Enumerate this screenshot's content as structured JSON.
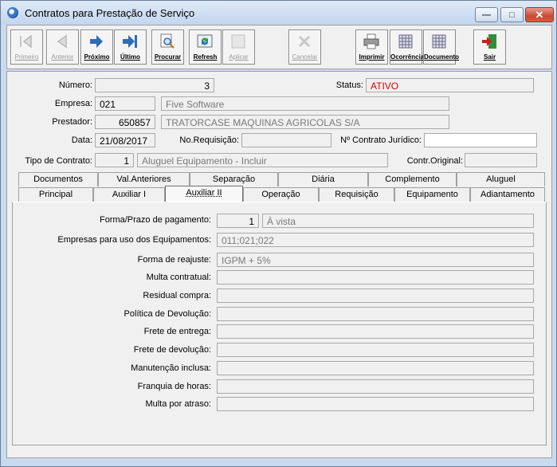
{
  "window": {
    "title": "Contratos para Prestação de Serviço",
    "minimize_icon": "minimize-icon",
    "maximize_icon": "maximize-icon",
    "close_icon": "close-icon"
  },
  "toolbar": {
    "primeiro": "Primeiro",
    "anterior": "Anterior",
    "proximo": "Próximo",
    "ultimo": "Último",
    "procurar": "Procurar",
    "refresh": "Refresh",
    "aplicar": "Aplicar",
    "cancelar": "Cancelar",
    "imprimir": "Imprimir",
    "ocorrencia": "Ocorrência",
    "documento": "Documento",
    "sair": "Sair"
  },
  "header": {
    "numero_label": "Número:",
    "numero": "3",
    "status_label": "Status:",
    "status": "ATIVO",
    "empresa_label": "Empresa:",
    "empresa_codigo": "021",
    "empresa_nome": "Five Software",
    "prestador_label": "Prestador:",
    "prestador_codigo": "650857",
    "prestador_nome": "TRATORCASE MAQUINAS AGRICOLAS S/A",
    "data_label": "Data:",
    "data": "21/08/2017",
    "requisicao_label": "No.Requisição:",
    "requisicao": "",
    "juridico_label": "Nº Contrato Jurídico:",
    "juridico": "",
    "tipo_label": "Tipo de Contrato:",
    "tipo_codigo": "1",
    "tipo_nome": "Aluguel Equipamento - Incluir",
    "original_label": "Contr.Original:",
    "original": ""
  },
  "tabs": {
    "row1": [
      "Documentos",
      "Val.Anteriores",
      "Separação",
      "Diária",
      "Complemento",
      "Aluguel"
    ],
    "row2": [
      "Principal",
      "Auxiliar I",
      "Auxiliar II",
      "Operação",
      "Requisição",
      "Equipamento",
      "Adiantamento"
    ],
    "active": "Auxiliar II"
  },
  "form": {
    "prazo_label": "Forma/Prazo de pagamento:",
    "prazo_codigo": "1",
    "prazo_desc": "À vista",
    "empresas_label": "Empresas para uso dos Equipamentos:",
    "empresas": "011;021;022",
    "reajuste_label": "Forma de reajuste:",
    "reajuste": "IGPM + 5%",
    "multa_contratual_label": "Multa contratual:",
    "multa_contratual": "",
    "residual_label": "Residual compra:",
    "residual": "",
    "devolucao_label": "Política de Devolução:",
    "devolucao": "",
    "frete_entrega_label": "Frete de entrega:",
    "frete_entrega": "",
    "frete_devolucao_label": "Frete de devolução:",
    "frete_devolucao": "",
    "manutencao_label": "Manutenção inclusa:",
    "manutencao": "",
    "franquia_label": "Franquia de horas:",
    "franquia": "",
    "multa_atraso_label": "Multa por atraso:",
    "multa_atraso": ""
  },
  "colors": {
    "status": "#e00000",
    "accent": "#3b78c4"
  }
}
